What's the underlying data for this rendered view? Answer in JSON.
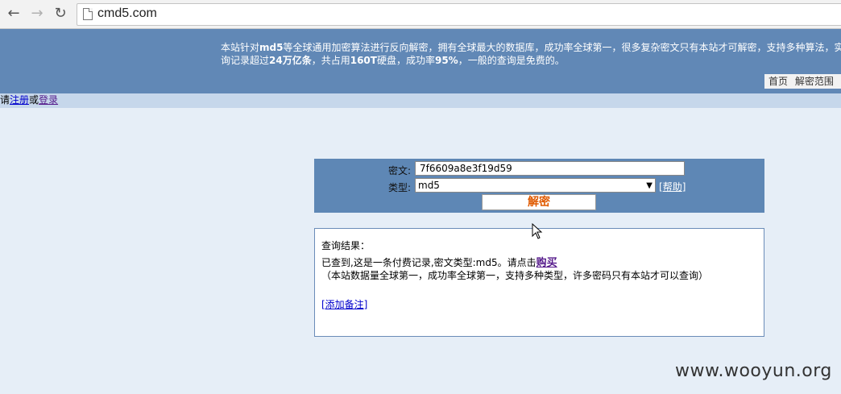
{
  "browser": {
    "back_icon": "arrow-left-icon",
    "forward_icon": "arrow-right-icon",
    "reload_icon": "reload-icon",
    "url": "cmd5.com"
  },
  "header": {
    "intro_parts": {
      "p1": "本站针对",
      "b1": "md5",
      "p2": "等全球通用加密算法进行反向解密，拥有全球最大的数据库，成功率全球第一，很多复杂密文只有本站才可解密，支持多种算法，实",
      "p3": "询记录超过",
      "b2": "24万亿条",
      "p4": "，共占用",
      "b3": "160T",
      "p5": "硬盘，成功率",
      "b4": "95%",
      "p6": "，一般的查询是免费的。"
    },
    "nav": {
      "home": "首页",
      "range": "解密范围"
    }
  },
  "subbar": {
    "please": "请",
    "register": "注册",
    "or": "或",
    "login": "登录"
  },
  "form": {
    "cipher_label": "密文:",
    "cipher_value": "7f6609a8e3f19d59",
    "type_label": "类型:",
    "type_value": "md5",
    "help_open": "[",
    "help_text": "帮助",
    "help_close": "]",
    "decrypt_label": "解密"
  },
  "result": {
    "title": "查询结果：",
    "found_text": "已查到,这是一条付费记录,密文类型:md5。请点击",
    "buy_label": "购买",
    "note": "（本站数据量全球第一，成功率全球第一，支持多种类型，许多密码只有本站才可以查询）",
    "add_note": "[添加备注]"
  },
  "watermark": "www.wooyun.org"
}
